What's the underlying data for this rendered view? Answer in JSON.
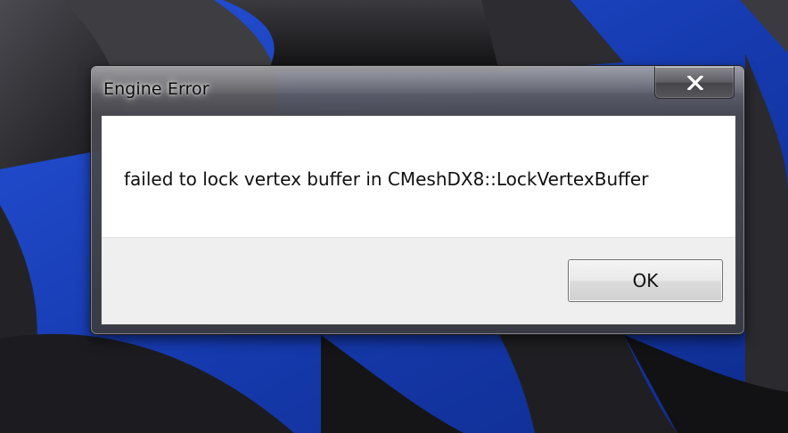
{
  "window": {
    "title": "Engine Error",
    "close_icon": "close-icon"
  },
  "dialog": {
    "message": "failed to lock vertex buffer in CMeshDX8::LockVertexBuffer",
    "ok_label": "OK"
  },
  "colors": {
    "desktop_blue": "#1a3fb8",
    "dialog_frame": "#4a4a50",
    "client_background": "#ffffff",
    "button_strip": "#efefef"
  }
}
